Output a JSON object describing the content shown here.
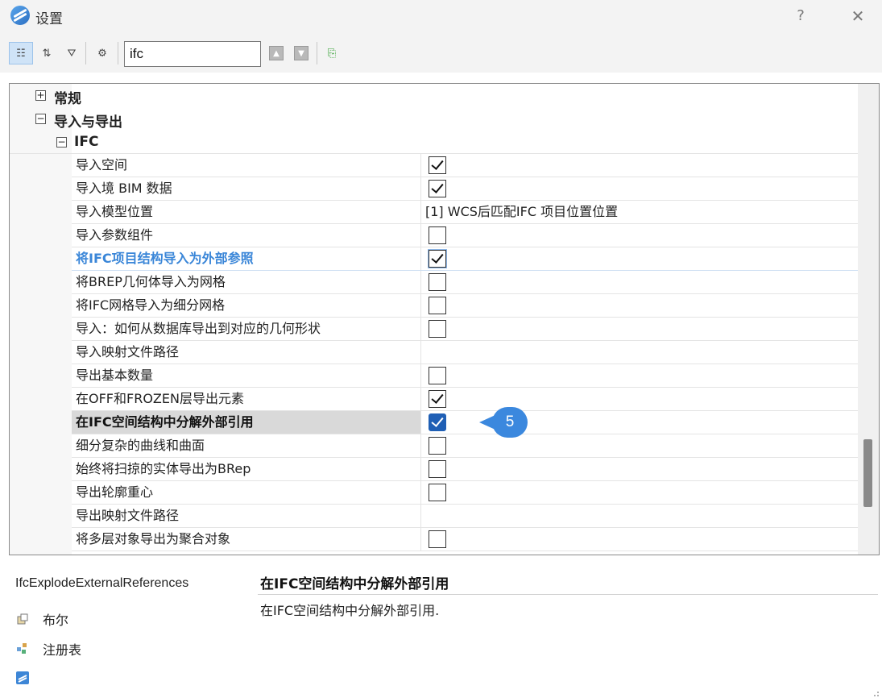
{
  "window": {
    "title": "设置",
    "help_label": "?",
    "close_label": "✕"
  },
  "toolbar": {
    "tools": [
      {
        "name": "categorized-view-icon",
        "glyph": "☷"
      },
      {
        "name": "sort-az-icon",
        "glyph": "⇅"
      },
      {
        "name": "filter-icon",
        "glyph": "⛛"
      },
      {
        "name": "settings-tree-icon",
        "glyph": "⚙"
      }
    ],
    "search_value": "ifc",
    "up_label": "▲",
    "down_label": "▼",
    "export_label": "⎘"
  },
  "tree": {
    "cat_general": "常规",
    "cat_import_export": "导入与导出",
    "cat_ifc": "IFC",
    "expand_plus": "+",
    "expand_minus": "−",
    "rows": [
      {
        "label": "导入空间",
        "type": "checkbox",
        "checked": true
      },
      {
        "label": "导入境 BIM 数据",
        "type": "checkbox",
        "checked": true
      },
      {
        "label": "导入模型位置",
        "type": "text",
        "value": "[1] WCS后匹配IFC 项目位置位置"
      },
      {
        "label": "导入参数组件",
        "type": "checkbox",
        "checked": false
      },
      {
        "label": "将IFC项目结构导入为外部参照",
        "type": "checkbox",
        "checked": true,
        "state": "highlight"
      },
      {
        "label": "将BREP几何体导入为网格",
        "type": "checkbox",
        "checked": false
      },
      {
        "label": "将IFC网格导入为细分网格",
        "type": "checkbox",
        "checked": false
      },
      {
        "label": "导入：如何从数据库导出到对应的几何形状",
        "type": "checkbox",
        "checked": false
      },
      {
        "label": "导入映射文件路径",
        "type": "text",
        "value": ""
      },
      {
        "label": "导出基本数量",
        "type": "checkbox",
        "checked": false
      },
      {
        "label": "在OFF和FROZEN层导出元素",
        "type": "checkbox",
        "checked": true
      },
      {
        "label": "在IFC空间结构中分解外部引用",
        "type": "checkbox",
        "checked": true,
        "state": "selected"
      },
      {
        "label": "细分复杂的曲线和曲面",
        "type": "checkbox",
        "checked": false
      },
      {
        "label": "始终将扫掠的实体导出为BRep",
        "type": "checkbox",
        "checked": false
      },
      {
        "label": "导出轮廓重心",
        "type": "checkbox",
        "checked": false
      },
      {
        "label": "导出映射文件路径",
        "type": "text",
        "value": ""
      },
      {
        "label": "将多层对象导出为聚合对象",
        "type": "checkbox",
        "checked": false
      }
    ]
  },
  "callout": {
    "number": "5",
    "color": "#3b88de"
  },
  "info": {
    "variable_name": "IfcExplodeExternalReferences",
    "type_label": "布尔",
    "storage_label": "注册表",
    "type_icon": "boolean-type-icon",
    "storage_icon": "registry-icon",
    "app_icon": "app-logo-icon"
  },
  "description": {
    "title": "在IFC空间结构中分解外部引用",
    "text": "在IFC空间结构中分解外部引用."
  },
  "colors": {
    "accent": "#3a86d8",
    "selected_row": "#d9d9d9",
    "checkbox_blue": "#1f5fb5"
  }
}
